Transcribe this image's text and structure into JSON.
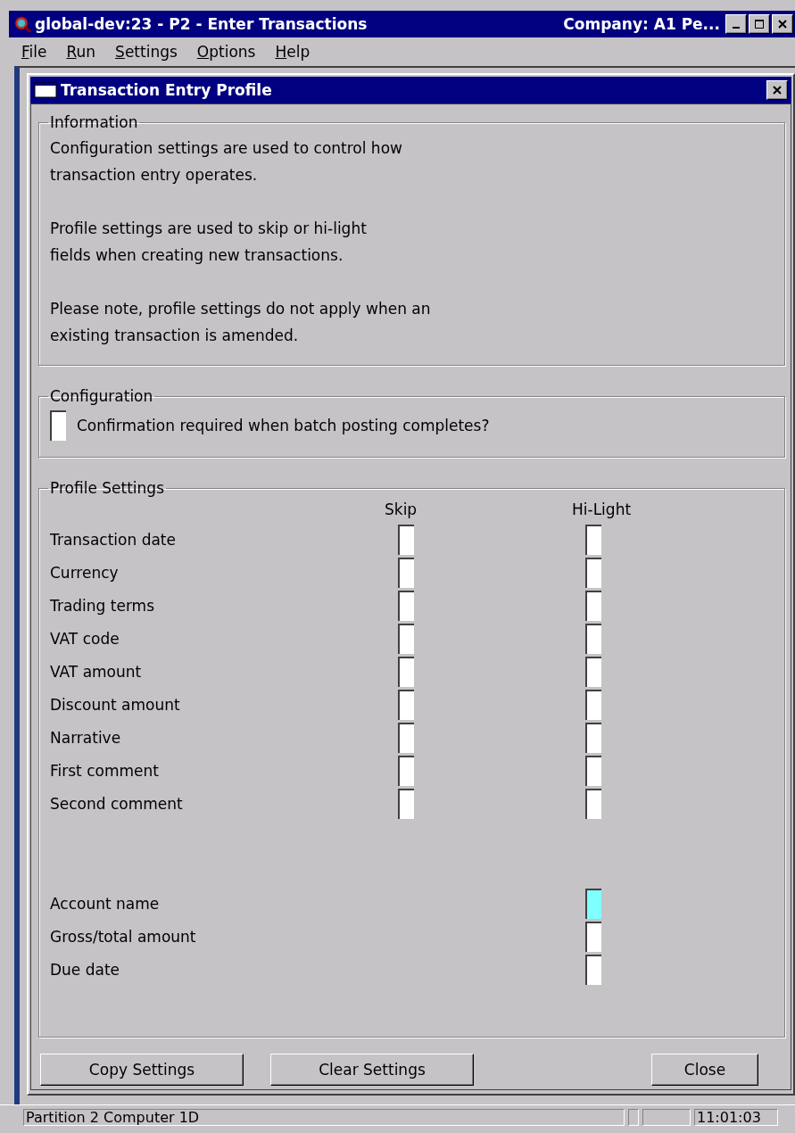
{
  "window": {
    "title": "global-dev:23 - P2 - Enter Transactions",
    "company": "Company: A1  Pe..."
  },
  "menu": [
    {
      "label": "File"
    },
    {
      "label": "Run"
    },
    {
      "label": "Settings"
    },
    {
      "label": "Options"
    },
    {
      "label": "Help"
    }
  ],
  "dialog": {
    "title": "Transaction Entry Profile"
  },
  "information": {
    "title": "Information",
    "paragraphs": [
      "Configuration settings are used to control how\ntransaction entry operates.",
      "Profile settings are used to skip or hi-light\nfields when creating new transactions.",
      "Please note, profile settings do not apply when an\nexisting transaction is amended."
    ]
  },
  "configuration": {
    "title": "Configuration",
    "items": [
      {
        "label": "Confirmation required when batch posting completes?",
        "focused": false
      }
    ]
  },
  "profile": {
    "title": "Profile Settings",
    "columns": [
      "Skip",
      "Hi-Light"
    ],
    "rows": [
      {
        "label": "Transaction date",
        "skip": {
          "focused": false
        },
        "highlight": {
          "focused": false
        }
      },
      {
        "label": "Currency",
        "skip": {
          "focused": false
        },
        "highlight": {
          "focused": false
        }
      },
      {
        "label": "Trading terms",
        "skip": {
          "focused": false
        },
        "highlight": {
          "focused": false
        }
      },
      {
        "label": "VAT code",
        "skip": {
          "focused": false
        },
        "highlight": {
          "focused": false
        }
      },
      {
        "label": "VAT amount",
        "skip": {
          "focused": false
        },
        "highlight": {
          "focused": false
        }
      },
      {
        "label": "Discount amount",
        "skip": {
          "focused": false
        },
        "highlight": {
          "focused": false
        }
      },
      {
        "label": "Narrative",
        "skip": {
          "focused": false
        },
        "highlight": {
          "focused": false
        }
      },
      {
        "label": "First comment",
        "skip": {
          "focused": false
        },
        "highlight": {
          "focused": false
        }
      },
      {
        "label": "Second comment",
        "skip": {
          "focused": false
        },
        "highlight": {
          "focused": false
        }
      }
    ],
    "highlight_only_rows": [
      {
        "label": "Account name",
        "highlight": {
          "focused": true
        }
      },
      {
        "label": "Gross/total amount",
        "highlight": {
          "focused": false
        }
      },
      {
        "label": "Due date",
        "highlight": {
          "focused": false
        }
      }
    ]
  },
  "buttons": [
    "Copy Settings",
    "Clear Settings",
    "Close"
  ],
  "status_bar": {
    "text": "Partition 2 Computer 1D",
    "time": "11:01:03"
  }
}
